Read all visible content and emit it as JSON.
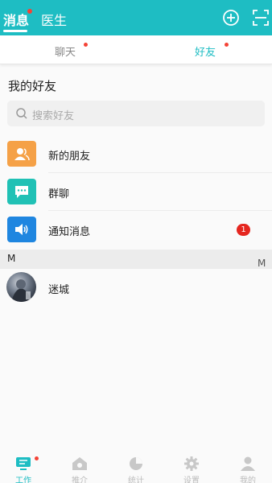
{
  "header": {
    "tabs": [
      {
        "label": "消息",
        "active": true
      },
      {
        "label": "医生",
        "active": false
      }
    ],
    "add_icon": "plus-circle-icon",
    "scan_icon": "scan-icon",
    "color": "#1ebdc3"
  },
  "subtabs": [
    {
      "label": "聊天",
      "active": false
    },
    {
      "label": "好友",
      "active": true
    }
  ],
  "friends_section": {
    "title": "我的好友",
    "search_placeholder": "搜索好友"
  },
  "items": [
    {
      "label": "新的朋友",
      "icon": "new-friend-icon",
      "color": "#f5a147"
    },
    {
      "label": "群聊",
      "icon": "group-chat-icon",
      "color": "#20c1b5"
    },
    {
      "label": "通知消息",
      "icon": "speaker-icon",
      "color": "#1f86e0",
      "badge": "1"
    }
  ],
  "letter_group": "M",
  "index_letter": "M",
  "friends": [
    {
      "name": "迷城"
    }
  ],
  "bottom_nav": [
    {
      "label": "工作",
      "icon": "work-icon",
      "active": true
    },
    {
      "label": "推介",
      "icon": "home-icon",
      "active": false
    },
    {
      "label": "统计",
      "icon": "pie-chart-icon",
      "active": false
    },
    {
      "label": "设置",
      "icon": "gear-icon",
      "active": false
    },
    {
      "label": "我的",
      "icon": "user-icon",
      "active": false
    }
  ]
}
